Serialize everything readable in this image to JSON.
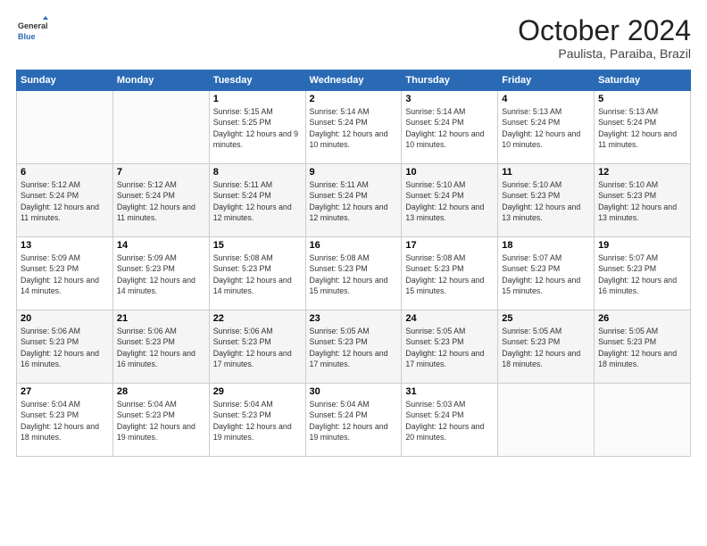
{
  "header": {
    "logo_general": "General",
    "logo_blue": "Blue",
    "month_title": "October 2024",
    "location": "Paulista, Paraiba, Brazil"
  },
  "days_of_week": [
    "Sunday",
    "Monday",
    "Tuesday",
    "Wednesday",
    "Thursday",
    "Friday",
    "Saturday"
  ],
  "weeks": [
    [
      {
        "day": "",
        "info": ""
      },
      {
        "day": "",
        "info": ""
      },
      {
        "day": "1",
        "info": "Sunrise: 5:15 AM\nSunset: 5:25 PM\nDaylight: 12 hours and 9 minutes."
      },
      {
        "day": "2",
        "info": "Sunrise: 5:14 AM\nSunset: 5:24 PM\nDaylight: 12 hours and 10 minutes."
      },
      {
        "day": "3",
        "info": "Sunrise: 5:14 AM\nSunset: 5:24 PM\nDaylight: 12 hours and 10 minutes."
      },
      {
        "day": "4",
        "info": "Sunrise: 5:13 AM\nSunset: 5:24 PM\nDaylight: 12 hours and 10 minutes."
      },
      {
        "day": "5",
        "info": "Sunrise: 5:13 AM\nSunset: 5:24 PM\nDaylight: 12 hours and 11 minutes."
      }
    ],
    [
      {
        "day": "6",
        "info": "Sunrise: 5:12 AM\nSunset: 5:24 PM\nDaylight: 12 hours and 11 minutes."
      },
      {
        "day": "7",
        "info": "Sunrise: 5:12 AM\nSunset: 5:24 PM\nDaylight: 12 hours and 11 minutes."
      },
      {
        "day": "8",
        "info": "Sunrise: 5:11 AM\nSunset: 5:24 PM\nDaylight: 12 hours and 12 minutes."
      },
      {
        "day": "9",
        "info": "Sunrise: 5:11 AM\nSunset: 5:24 PM\nDaylight: 12 hours and 12 minutes."
      },
      {
        "day": "10",
        "info": "Sunrise: 5:10 AM\nSunset: 5:24 PM\nDaylight: 12 hours and 13 minutes."
      },
      {
        "day": "11",
        "info": "Sunrise: 5:10 AM\nSunset: 5:23 PM\nDaylight: 12 hours and 13 minutes."
      },
      {
        "day": "12",
        "info": "Sunrise: 5:10 AM\nSunset: 5:23 PM\nDaylight: 12 hours and 13 minutes."
      }
    ],
    [
      {
        "day": "13",
        "info": "Sunrise: 5:09 AM\nSunset: 5:23 PM\nDaylight: 12 hours and 14 minutes."
      },
      {
        "day": "14",
        "info": "Sunrise: 5:09 AM\nSunset: 5:23 PM\nDaylight: 12 hours and 14 minutes."
      },
      {
        "day": "15",
        "info": "Sunrise: 5:08 AM\nSunset: 5:23 PM\nDaylight: 12 hours and 14 minutes."
      },
      {
        "day": "16",
        "info": "Sunrise: 5:08 AM\nSunset: 5:23 PM\nDaylight: 12 hours and 15 minutes."
      },
      {
        "day": "17",
        "info": "Sunrise: 5:08 AM\nSunset: 5:23 PM\nDaylight: 12 hours and 15 minutes."
      },
      {
        "day": "18",
        "info": "Sunrise: 5:07 AM\nSunset: 5:23 PM\nDaylight: 12 hours and 15 minutes."
      },
      {
        "day": "19",
        "info": "Sunrise: 5:07 AM\nSunset: 5:23 PM\nDaylight: 12 hours and 16 minutes."
      }
    ],
    [
      {
        "day": "20",
        "info": "Sunrise: 5:06 AM\nSunset: 5:23 PM\nDaylight: 12 hours and 16 minutes."
      },
      {
        "day": "21",
        "info": "Sunrise: 5:06 AM\nSunset: 5:23 PM\nDaylight: 12 hours and 16 minutes."
      },
      {
        "day": "22",
        "info": "Sunrise: 5:06 AM\nSunset: 5:23 PM\nDaylight: 12 hours and 17 minutes."
      },
      {
        "day": "23",
        "info": "Sunrise: 5:05 AM\nSunset: 5:23 PM\nDaylight: 12 hours and 17 minutes."
      },
      {
        "day": "24",
        "info": "Sunrise: 5:05 AM\nSunset: 5:23 PM\nDaylight: 12 hours and 17 minutes."
      },
      {
        "day": "25",
        "info": "Sunrise: 5:05 AM\nSunset: 5:23 PM\nDaylight: 12 hours and 18 minutes."
      },
      {
        "day": "26",
        "info": "Sunrise: 5:05 AM\nSunset: 5:23 PM\nDaylight: 12 hours and 18 minutes."
      }
    ],
    [
      {
        "day": "27",
        "info": "Sunrise: 5:04 AM\nSunset: 5:23 PM\nDaylight: 12 hours and 18 minutes."
      },
      {
        "day": "28",
        "info": "Sunrise: 5:04 AM\nSunset: 5:23 PM\nDaylight: 12 hours and 19 minutes."
      },
      {
        "day": "29",
        "info": "Sunrise: 5:04 AM\nSunset: 5:23 PM\nDaylight: 12 hours and 19 minutes."
      },
      {
        "day": "30",
        "info": "Sunrise: 5:04 AM\nSunset: 5:24 PM\nDaylight: 12 hours and 19 minutes."
      },
      {
        "day": "31",
        "info": "Sunrise: 5:03 AM\nSunset: 5:24 PM\nDaylight: 12 hours and 20 minutes."
      },
      {
        "day": "",
        "info": ""
      },
      {
        "day": "",
        "info": ""
      }
    ]
  ]
}
